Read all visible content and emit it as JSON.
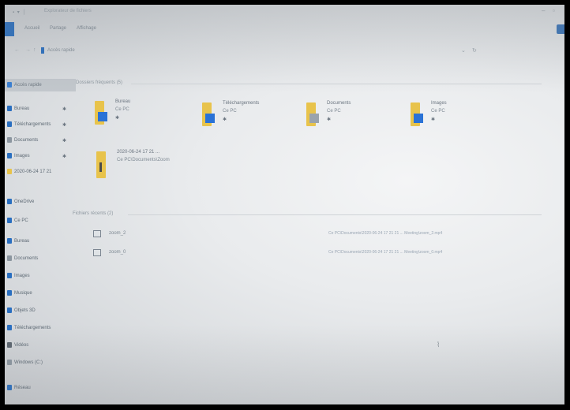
{
  "window": {
    "title": "Explorateur de fichiers"
  },
  "ribbon": {
    "tabs": [
      "Fichier",
      "Accueil",
      "Partage",
      "Affichage"
    ]
  },
  "address": {
    "path": "Accès rapide"
  },
  "sidebar": {
    "items": [
      {
        "label": "Accès rapide",
        "icon": "star-icon",
        "color": "#3b7fd1",
        "pinned": false,
        "selected": true
      },
      {
        "label": "Bureau",
        "icon": "desktop-icon",
        "color": "#2a6fc0",
        "pinned": true
      },
      {
        "label": "Téléchargements",
        "icon": "download-icon",
        "color": "#2a6fc0",
        "pinned": true
      },
      {
        "label": "Documents",
        "icon": "document-icon",
        "color": "#8c96a0",
        "pinned": true
      },
      {
        "label": "Images",
        "icon": "picture-icon",
        "color": "#2a6fc0",
        "pinned": true
      },
      {
        "label": "2020-06-24 17 21",
        "icon": "folder-icon",
        "color": "#e8c34b",
        "pinned": false
      },
      {
        "label": "OneDrive",
        "icon": "cloud-icon",
        "color": "#2a6fc0",
        "pinned": false
      },
      {
        "label": "Ce PC",
        "icon": "computer-icon",
        "color": "#2a6fc0",
        "pinned": false
      },
      {
        "label": "Bureau",
        "icon": "desktop-icon",
        "color": "#2a6fc0",
        "pinned": false
      },
      {
        "label": "Documents",
        "icon": "document-icon",
        "color": "#8c96a0",
        "pinned": false
      },
      {
        "label": "Images",
        "icon": "picture-icon",
        "color": "#2a6fc0",
        "pinned": false
      },
      {
        "label": "Musique",
        "icon": "music-icon",
        "color": "#2a6fc0",
        "pinned": false
      },
      {
        "label": "Objets 3D",
        "icon": "cube-icon",
        "color": "#2a6fc0",
        "pinned": false
      },
      {
        "label": "Téléchargements",
        "icon": "download-icon",
        "color": "#2a6fc0",
        "pinned": false
      },
      {
        "label": "Vidéos",
        "icon": "video-icon",
        "color": "#5d6670",
        "pinned": false
      },
      {
        "label": "Windows (C:)",
        "icon": "drive-icon",
        "color": "#8c96a0",
        "pinned": false
      },
      {
        "label": "Réseau",
        "icon": "network-icon",
        "color": "#2a6fc0",
        "pinned": false
      }
    ]
  },
  "frequent": {
    "header": "Dossiers fréquents (5)",
    "folders": [
      {
        "name": "Bureau",
        "location": "Ce PC",
        "badge": "desktop-icon",
        "badge_color": "#2a72d6"
      },
      {
        "name": "Téléchargements",
        "location": "Ce PC",
        "badge": "download-icon",
        "badge_color": "#2a72d6"
      },
      {
        "name": "Documents",
        "location": "Ce PC",
        "badge": "document-icon",
        "badge_color": "#9aa3ac"
      },
      {
        "name": "Images",
        "location": "Ce PC",
        "badge": "picture-icon",
        "badge_color": "#2a72d6"
      },
      {
        "name": "2020-06-24 17 21 ...",
        "location": "Ce PC\\Documents\\Zoom",
        "badge": "none",
        "badge_color": "#e8c34b"
      }
    ]
  },
  "recent": {
    "header": "Fichiers récents (2)",
    "files": [
      {
        "name": "zoom_2",
        "path": "Ce PC\\Documents\\2020-06-24 17 21 21 ... Meeting\\zoom_2.mp4"
      },
      {
        "name": "zoom_0",
        "path": "Ce PC\\Documents\\2020-06-24 17 21 21 ... Meeting\\zoom_0.mp4"
      }
    ]
  },
  "pin_glyph": "✱"
}
